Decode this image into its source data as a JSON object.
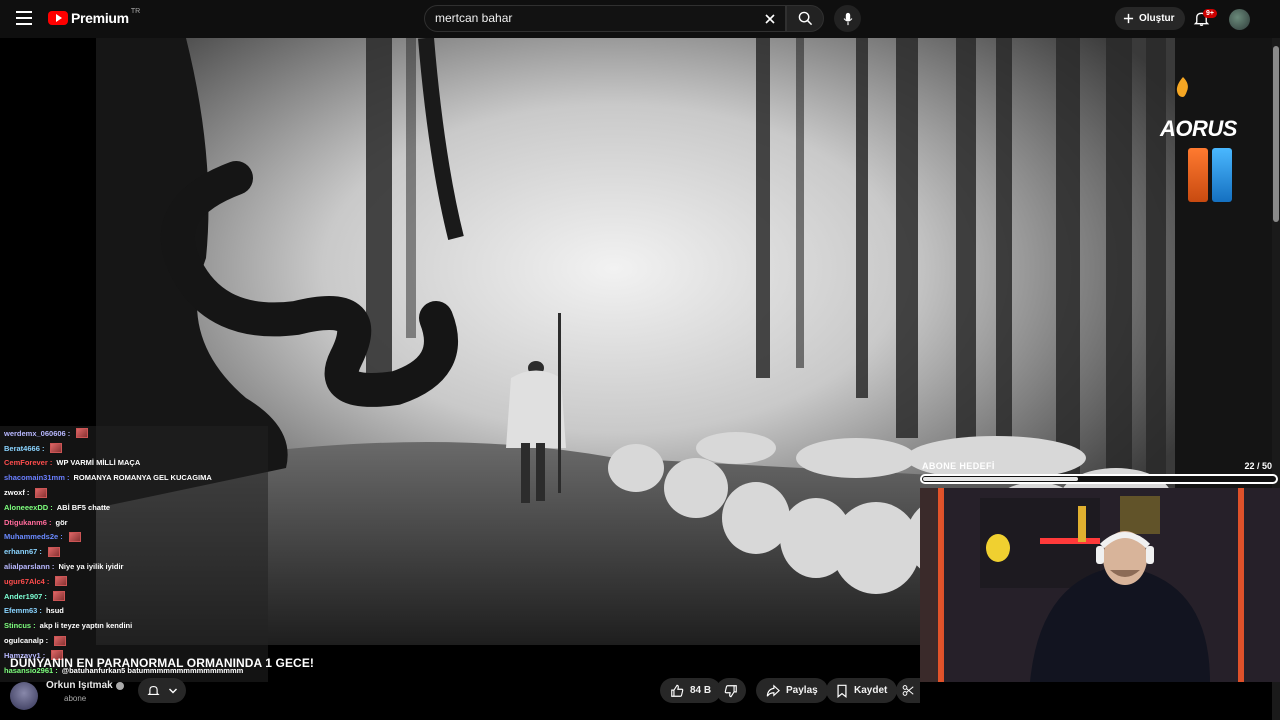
{
  "header": {
    "brand": "Premium",
    "region": "TR",
    "search_value": "mertcan bahar",
    "create_label": "Oluştur",
    "notif_badge": "9+"
  },
  "overlay": {
    "brand_text": "AORUS",
    "goal_label": "ABONE HEDEFİ",
    "goal_count": "22  / 50",
    "goal_progress": 0.44
  },
  "chat": {
    "messages": [
      {
        "user": "werdemx_060606 :",
        "color": "#b8b8ff",
        "text": "",
        "emote": true
      },
      {
        "user": "Berat4666 :",
        "color": "#8ad4ff",
        "text": "",
        "emote": true
      },
      {
        "user": "CemForever :",
        "color": "#ff4d4d",
        "text": "WP VARMİ MİLLİ MAÇA",
        "emote": false
      },
      {
        "user": "shacomain31mm :",
        "color": "#6a7fff",
        "text": "ROMANYA ROMANYA GEL KUCAGIMA",
        "emote": false
      },
      {
        "user": "zwoxf :",
        "color": "#ffffff",
        "text": "",
        "emote": true
      },
      {
        "user": "AloneeexDD :",
        "color": "#7dff7d",
        "text": "ABİ BF5 chatte",
        "emote": false
      },
      {
        "user": "Dtigukanm6 :",
        "color": "#ff6a9a",
        "text": "gör",
        "emote": false
      },
      {
        "user": "Muhammeds2e :",
        "color": "#6a8aff",
        "text": "",
        "emote": true
      },
      {
        "user": "erhann67 :",
        "color": "#8ad4ff",
        "text": "",
        "emote": true
      },
      {
        "user": "alialparslann :",
        "color": "#b8b8ff",
        "text": "Niye ya iyilik iyidir",
        "emote": false
      },
      {
        "user": "ugur67Alc4 :",
        "color": "#ff4d4d",
        "text": "",
        "emote": true
      },
      {
        "user": "Ander1907 :",
        "color": "#7dffd4",
        "text": "",
        "emote": true
      },
      {
        "user": "Efemm63 :",
        "color": "#8ad4ff",
        "text": "hsud",
        "emote": false
      },
      {
        "user": "Stincus :",
        "color": "#7dff7d",
        "text": "akp li teyze yaptın kendini",
        "emote": false
      },
      {
        "user": "ogulcanalp :",
        "color": "#ffffff",
        "text": "",
        "emote": true
      },
      {
        "user": "Hamzayy1 :",
        "color": "#b8b8ff",
        "text": "",
        "emote": true
      },
      {
        "user": "hasansio2961 :",
        "color": "#7dff7d",
        "text": "@batuhanfurkan5 batummmmmmmmmmmmmmm",
        "emote": false
      }
    ]
  },
  "video": {
    "title": "DÜNYANIN EN PARANORMAL ORMANINDA 1 GECE!",
    "channel": "Orkun Işıtmak",
    "subscribe_state": "abone",
    "likes": "84 B",
    "share_label": "Paylaş",
    "save_label": "Kaydet"
  },
  "colors": {
    "background": "#0f0f0f",
    "brand_red": "#ff0000",
    "pill": "#272727",
    "badge": "#cc0000"
  },
  "icons": [
    "menu-icon",
    "youtube-logo",
    "clear-icon",
    "search-icon",
    "mic-icon",
    "plus-icon",
    "bell-icon",
    "like-icon",
    "dislike-icon",
    "share-icon",
    "bookmark-icon",
    "scissors-icon"
  ]
}
